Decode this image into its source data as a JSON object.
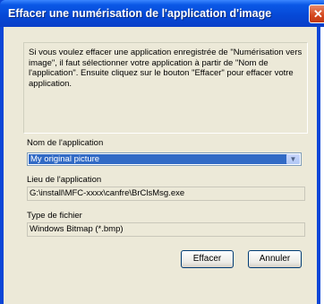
{
  "window": {
    "title": "Effacer une numérisation de l'application d'image",
    "close_glyph": "✕"
  },
  "dialog": {
    "description": "Si vous voulez effacer une application enregistrée de \"Numérisation vers image\", il faut sélectionner votre application à partir de \"Nom de l'application\". Ensuite cliquez sur le bouton \"Effacer\" pour effacer votre application.",
    "app_name_label": "Nom de l'application",
    "app_name_value": "My original picture",
    "app_location_label": "Lieu de l'application",
    "app_location_value": "G:\\install\\MFC-xxxx\\canfre\\BrClsMsg.exe",
    "file_type_label": "Type de fichier",
    "file_type_value": "Windows Bitmap (*.bmp)"
  },
  "buttons": {
    "delete_label": "Effacer",
    "cancel_label": "Annuler"
  }
}
